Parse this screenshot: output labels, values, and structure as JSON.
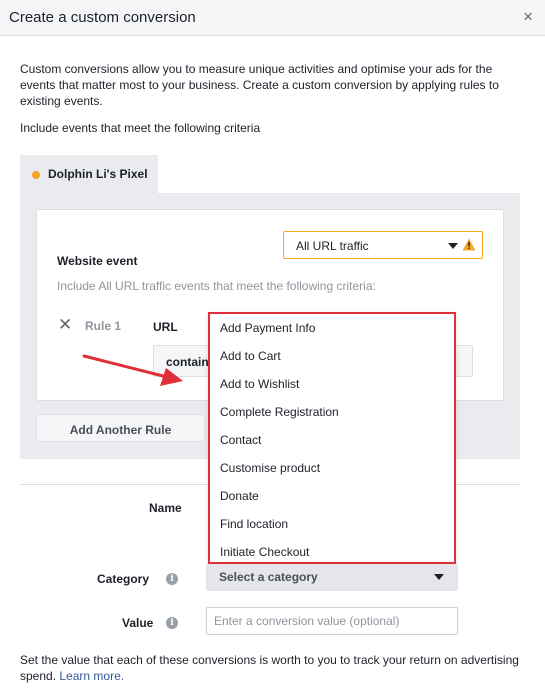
{
  "dialog": {
    "title": "Create a custom conversion",
    "close_glyph": "×"
  },
  "intro": {
    "description": "Custom conversions allow you to measure unique activities and optimise your ads for the events that matter most to your business. Create a custom conversion by applying rules to existing events.",
    "criteria_text": "Include events that meet the following criteria"
  },
  "pixel": {
    "name": "Dolphin Li's Pixel",
    "dot_color": "#f5a623"
  },
  "rule_panel": {
    "website_event_label": "Website event",
    "website_event_value": "All URL traffic",
    "warning_color": "#f5a623",
    "include_text": "Include All URL traffic events that meet the following criteria:",
    "remove_glyph": "✕",
    "rule_label": "Rule 1",
    "url_label": "URL",
    "condition_value": "contains",
    "add_rule_label": "Add Another Rule"
  },
  "event_dropdown": {
    "border_color": "#e02f38",
    "options": [
      "Add Payment Info",
      "Add to Cart",
      "Add to Wishlist",
      "Complete Registration",
      "Contact",
      "Customise product",
      "Donate",
      "Find location",
      "Initiate Checkout"
    ]
  },
  "form": {
    "name_label": "Name",
    "category_label": "Category",
    "category_value": "Select a category",
    "value_label": "Value",
    "value_placeholder": "Enter a conversion value (optional)",
    "info_glyph": "i"
  },
  "footer": {
    "text": "Set the value that each of these conversions is worth to you to track your return on advertising spend.",
    "learn_more": "Learn more."
  },
  "annotation": {
    "arrow_color": "#e02f38"
  }
}
